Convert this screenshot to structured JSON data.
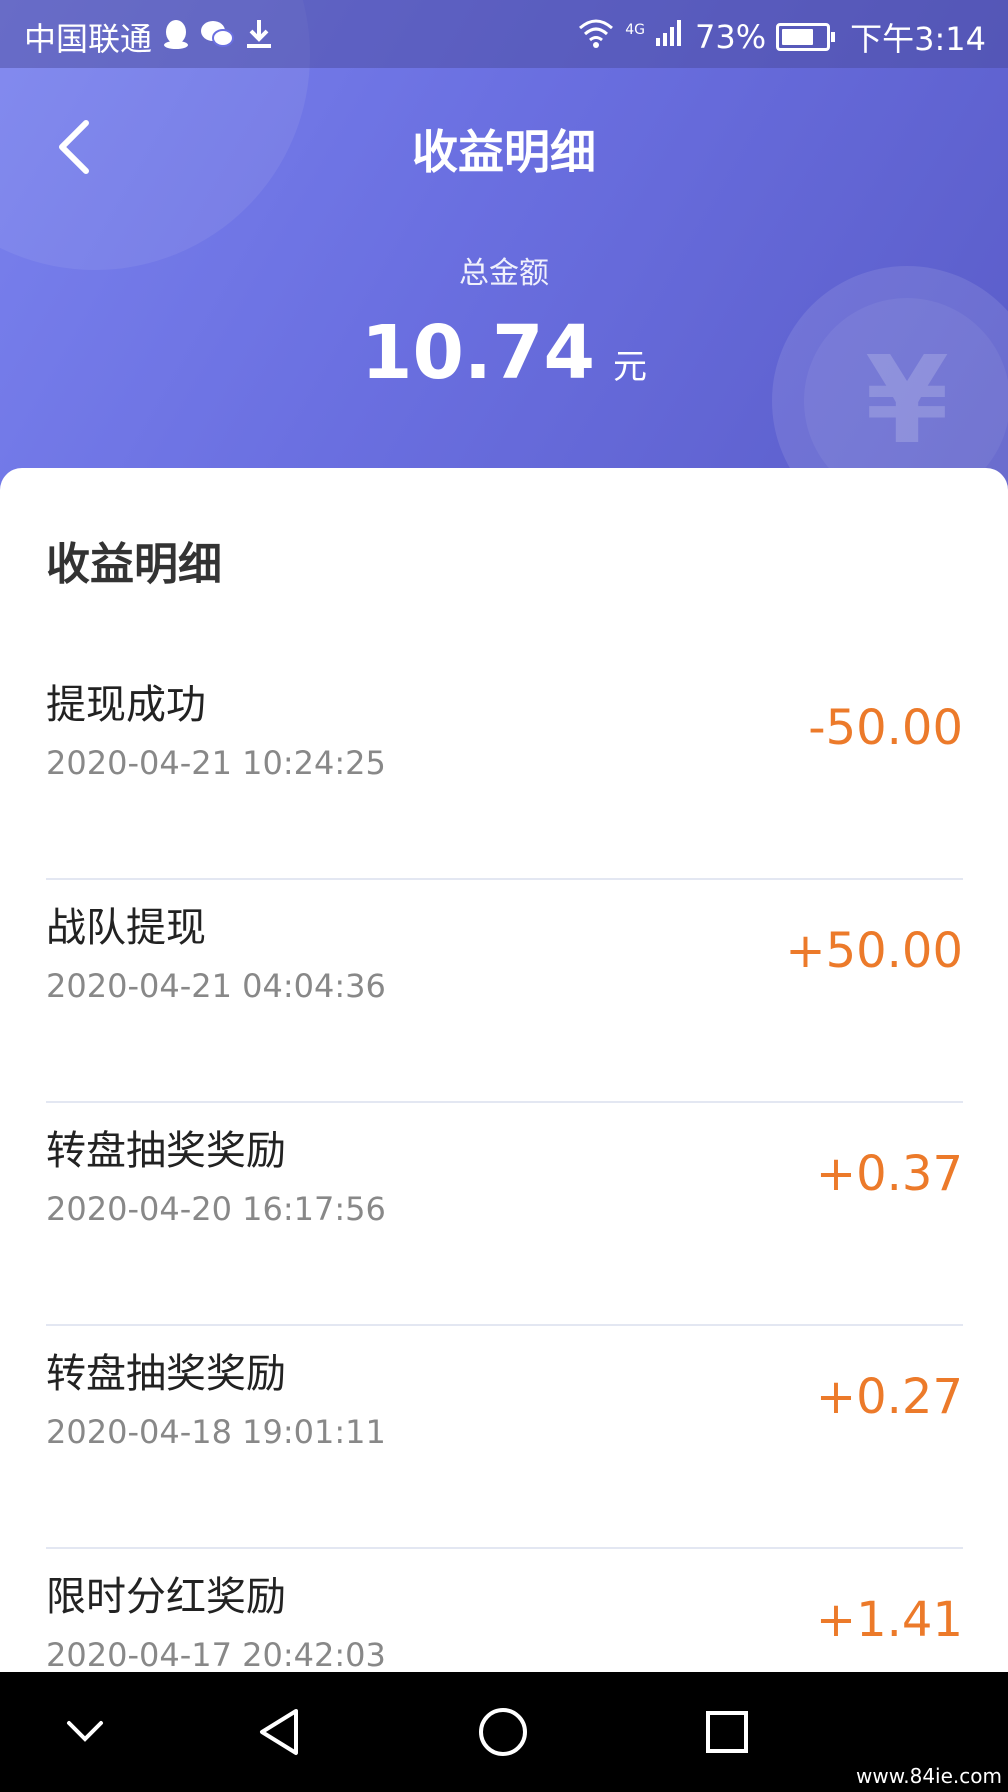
{
  "statusbar": {
    "carrier": "中国联通",
    "network": "4G",
    "battery_percent": "73%",
    "battery_level": 0.73,
    "time": "下午3:14",
    "icons": [
      "qq-icon",
      "wechat-icon",
      "download-icon",
      "wifi-icon",
      "signal-icon",
      "battery-icon"
    ]
  },
  "header": {
    "back_icon": "chevron-left-icon",
    "title": "收益明细",
    "total_label": "总金额",
    "total_amount": "10.74",
    "total_unit": "元",
    "decoration": "yen-coin-icon",
    "yen_symbol": "¥"
  },
  "details": {
    "section_title": "收益明细",
    "items": [
      {
        "title": "提现成功",
        "time": "2020-04-21 10:24:25",
        "amount": "-50.00"
      },
      {
        "title": "战队提现",
        "time": "2020-04-21 04:04:36",
        "amount": "+50.00"
      },
      {
        "title": "转盘抽奖奖励",
        "time": "2020-04-20 16:17:56",
        "amount": "+0.37"
      },
      {
        "title": "转盘抽奖奖励",
        "time": "2020-04-18 19:01:11",
        "amount": "+0.27"
      },
      {
        "title": "限时分红奖励",
        "time": "2020-04-17 20:42:03",
        "amount": "+1.41"
      }
    ]
  },
  "navbar": {
    "buttons": [
      "chevron-down-icon",
      "back-triangle-icon",
      "home-circle-icon",
      "recents-square-icon"
    ]
  },
  "watermark": "www.84ie.com",
  "colors": {
    "header_gradient_start": "#7a82ee",
    "header_gradient_end": "#5a5cc8",
    "amount": "#ec7a2a"
  }
}
